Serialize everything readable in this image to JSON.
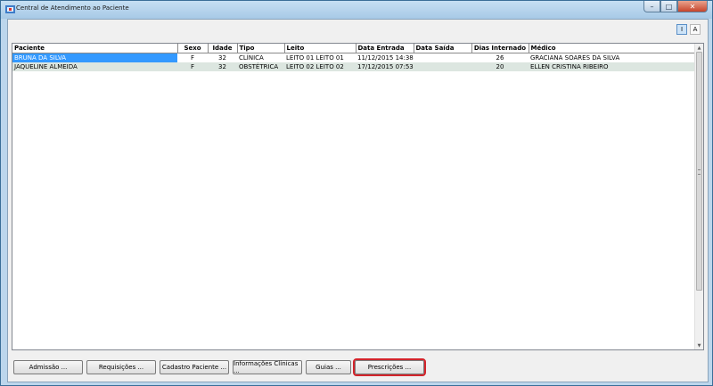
{
  "window": {
    "title": "Central de Atendimento ao Paciente"
  },
  "toggles": {
    "i": "I",
    "a": "A"
  },
  "table": {
    "columns": [
      "Paciente",
      "Sexo",
      "Idade",
      "Tipo",
      "Leito",
      "Data Entrada",
      "Data Saída",
      "Dias Internado",
      "Médico"
    ],
    "rows": [
      [
        "BRUNA DA SILVA",
        "F",
        "32",
        "CLÍNICA",
        "LEITO 01 LEITO 01",
        "11/12/2015 14:38",
        "",
        "26",
        "GRACIANA SOARES DA SILVA"
      ],
      [
        "JAQUELINE ALMEIDA",
        "F",
        "32",
        "OBSTÉTRICA",
        "LEITO 02 LEITO 02",
        "17/12/2015 07:53",
        "",
        "20",
        "ELLEN CRISTINA RIBEIRO"
      ]
    ]
  },
  "buttons": {
    "admissao": "Admissão ...",
    "requisicoes": "Requisições ...",
    "cadastro": "Cadastro Paciente ...",
    "informacoes": "Informações Clínicas ...",
    "guias": "Guias ...",
    "prescricoes": "Prescrições ..."
  }
}
